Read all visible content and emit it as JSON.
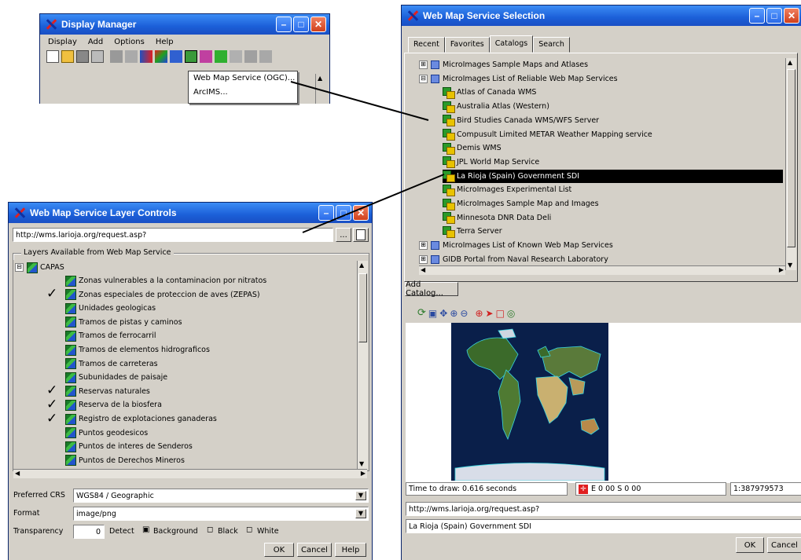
{
  "display_manager": {
    "title": "Display Manager",
    "menu": [
      "Display",
      "Add",
      "Options",
      "Help"
    ],
    "dropdown": [
      "Web Map Service (OGC)...",
      "ArcIMS..."
    ]
  },
  "layer_controls": {
    "title": "Web Map Service Layer Controls",
    "url": "http://wms.larioja.org/request.asp?",
    "browse_label": "...",
    "group_label": "Layers Available from Web Map Service",
    "root": "CAPAS",
    "root_expander": "⊟",
    "layers": [
      {
        "name": "Zonas vulnerables a la contaminacion por nitratos",
        "checked": false
      },
      {
        "name": "Zonas especiales de proteccion de aves (ZEPAS)",
        "checked": true
      },
      {
        "name": "Unidades geologicas",
        "checked": false
      },
      {
        "name": "Tramos de pistas y caminos",
        "checked": false
      },
      {
        "name": "Tramos de ferrocarril",
        "checked": false
      },
      {
        "name": "Tramos de elementos hidrograficos",
        "checked": false
      },
      {
        "name": "Tramos de carreteras",
        "checked": false
      },
      {
        "name": "Subunidades de paisaje",
        "checked": false
      },
      {
        "name": "Reservas naturales",
        "checked": true
      },
      {
        "name": "Reserva de la biosfera",
        "checked": true
      },
      {
        "name": "Registro de explotaciones ganaderas",
        "checked": true
      },
      {
        "name": "Puntos geodesicos",
        "checked": false
      },
      {
        "name": "Puntos de interes de Senderos",
        "checked": false
      },
      {
        "name": "Puntos de Derechos Mineros",
        "checked": false
      }
    ],
    "crs_label": "Preferred CRS",
    "crs_value": "WGS84 / Geographic",
    "format_label": "Format",
    "format_value": "image/png",
    "transparency_label": "Transparency",
    "transparency_value": "0",
    "detect_label": "Detect",
    "opt_background": "Background",
    "opt_black": "Black",
    "opt_white": "White",
    "ok": "OK",
    "cancel": "Cancel",
    "help": "Help"
  },
  "wms_selection": {
    "title": "Web Map Service Selection",
    "tabs": [
      "Recent",
      "Favorites",
      "Catalogs",
      "Search"
    ],
    "active_tab": "Catalogs",
    "catalogs_top": [
      {
        "expander": "⊞",
        "label": "MicroImages Sample Maps and Atlases"
      },
      {
        "expander": "⊟",
        "label": "MicroImages List of Reliable Web Map Services"
      }
    ],
    "services": [
      "Atlas of Canada WMS",
      "Australia Atlas (Western)",
      "Bird Studies Canada WMS/WFS Server",
      "Compusult Limited METAR Weather Mapping service",
      "Demis WMS",
      "JPL World Map Service",
      "La Rioja (Spain) Government SDI",
      "MicroImages Experimental List",
      "MicroImages Sample Map and Images",
      "Minnesota DNR Data Deli",
      "Terra Server"
    ],
    "selected_service": "La Rioja (Spain) Government SDI",
    "catalogs_bottom": [
      {
        "expander": "⊞",
        "label": "MicroImages List of Known Web Map Services"
      },
      {
        "expander": "⊞",
        "label": "GIDB Portal from Naval Research Laboratory"
      }
    ],
    "add_catalog": "Add Catalog...",
    "status_time": "Time to draw: 0.616 seconds",
    "status_coords": "E 0 00  S 0 00",
    "status_scale": "1:387979573",
    "url": "http://wms.larioja.org/request.asp?",
    "service_name": "La Rioja (Spain) Government SDI",
    "ok": "OK",
    "cancel": "Cancel"
  },
  "colors": {
    "titlebar": "#1b5fd8",
    "selection": "#000000",
    "map_ocean": "#0a1f4a",
    "coast": "#3ad6e0"
  }
}
